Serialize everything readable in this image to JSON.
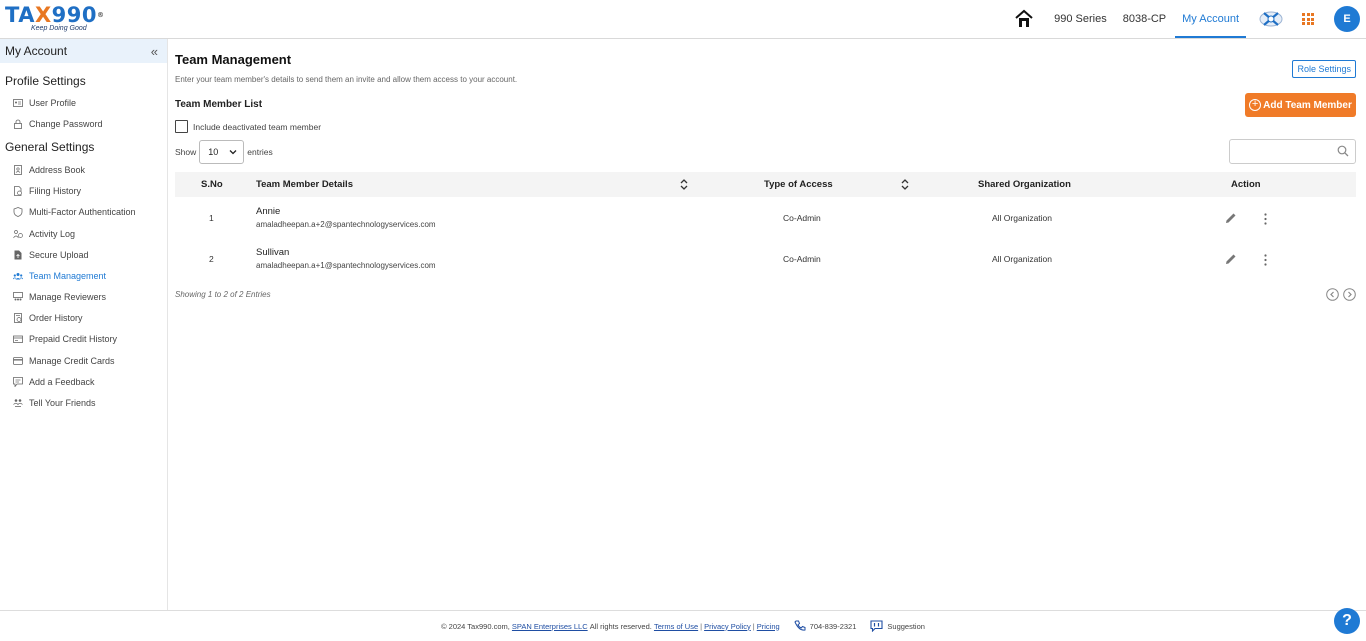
{
  "header": {
    "logo_text_a": "TA",
    "logo_text_x": "X",
    "logo_text_b": "990",
    "logo_reg": "®",
    "logo_tagline": "Keep Doing Good",
    "nav": {
      "link1": "990 Series",
      "link2": "8038-CP",
      "link3": "My Account"
    },
    "avatar_initial": "E"
  },
  "sidebar": {
    "title": "My Account",
    "collapse_icon": "«",
    "profile_section": "Profile Settings",
    "profile_items": [
      "User Profile",
      "Change Password"
    ],
    "general_section": "General Settings",
    "general_items": [
      "Address Book",
      "Filing History",
      "Multi-Factor Authentication",
      "Activity Log",
      "Secure Upload",
      "Team Management",
      "Manage Reviewers",
      "Order History",
      "Prepaid Credit History",
      "Manage Credit Cards",
      "Add a Feedback",
      "Tell Your Friends"
    ],
    "active_item": "Team Management"
  },
  "main": {
    "title": "Team Management",
    "subtitle": "Enter your team member's details to send them an invite and allow them access to your account.",
    "role_settings": "Role Settings",
    "list_title": "Team Member List",
    "add_button": "Add Team Member",
    "include_deactivated": "Include deactivated team member",
    "show_label": "Show",
    "entries_value": "10",
    "entries_label": "entries",
    "columns": {
      "sno": "S.No",
      "details": "Team Member Details",
      "access": "Type of Access",
      "org": "Shared Organization",
      "action": "Action"
    },
    "rows": [
      {
        "sno": "1",
        "name": "Annie",
        "email": "amaladheepan.a+2@spantechnologyservices.com",
        "access": "Co-Admin",
        "org": "All Organization"
      },
      {
        "sno": "2",
        "name": "Sullivan",
        "email": "amaladheepan.a+1@spantechnologyservices.com",
        "access": "Co-Admin",
        "org": "All Organization"
      }
    ],
    "showing": "Showing 1 to 2 of 2 Entries"
  },
  "footer": {
    "copyright": "© 2024 Tax990.com,",
    "company": "SPAN Enterprises LLC",
    "rights": "All rights reserved.",
    "terms": "Terms of Use",
    "privacy": "Privacy Policy",
    "pricing": "Pricing",
    "sep": "|",
    "phone": "704-839-2321",
    "suggestion": "Suggestion"
  },
  "help_label": "?",
  "colors": {
    "brand_blue": "#1f7ad4",
    "brand_orange": "#f07b28"
  }
}
